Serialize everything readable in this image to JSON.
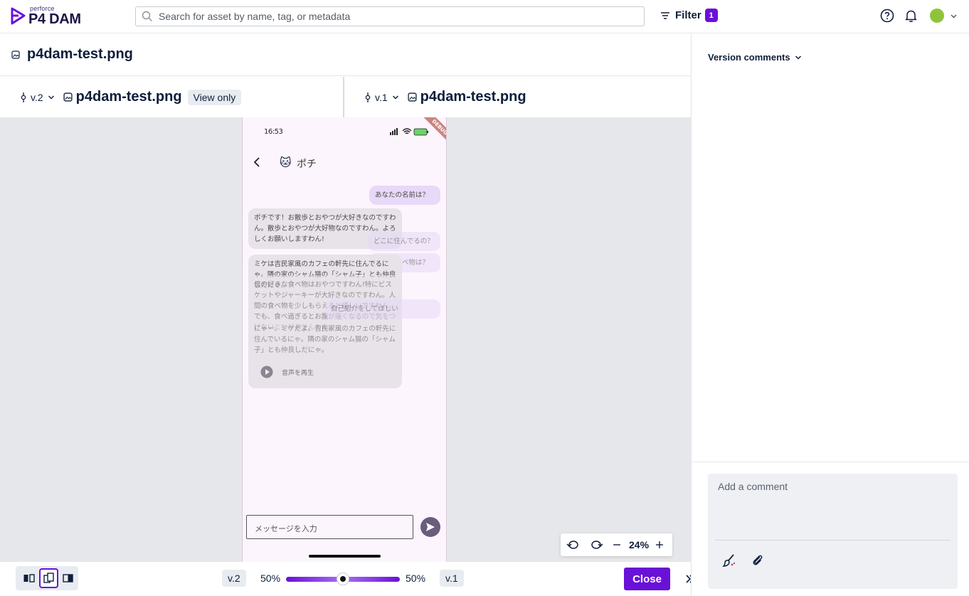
{
  "header": {
    "logo_small": "perforce",
    "logo_big": "P4 DAM",
    "search_placeholder": "Search for asset by name, tag, or metadata",
    "filter_label": "Filter",
    "filter_count": "1"
  },
  "asset": {
    "title": "p4dam-test.png"
  },
  "compare": {
    "left": {
      "version": "v.2",
      "title": "p4dam-test.png",
      "badge": "View only"
    },
    "right": {
      "version": "v.1",
      "title": "p4dam-test.png"
    }
  },
  "phone": {
    "time": "16:53",
    "debug": "DEBUG",
    "chat_name": "ポチ",
    "cat_emoji": "🐱",
    "bubbles": [
      "あなたの名前は？",
      "ポチです！お散歩とおやつが大好きなのですわん。散歩とおやつが大好物なのですわん。よろしくお願いしますわん!",
      "どこに住んでるの？",
      "好きな食べ物は？",
      "ミケは吉民家風のカフェの軒先に住んでるにゃ。隣の家のシャム猫の「シャム子」とも仲良しだにゃ。",
      "僕の好きな食べ物はおやつですわん!特にビスケットやジャーキーが大好きなのですわん。人間の食べ物を少しもらえると嬉しいですわん。でも、食べ過ぎるとお腹が痛くなるので気をつけないといけませんわん。",
      "自己紹介をしてほしい",
      "にゃー、ミケだよ。吉民家風のカフェの軒先に住んでいるにゃ。隣の家のシャム猫の「シャム子」とも仲良しだにゃ。"
    ],
    "play_label": "音声を再生",
    "input_placeholder": "メッセージを入力"
  },
  "zoom": {
    "value": "24%"
  },
  "bottom": {
    "left_version": "v.2",
    "left_pct": "50%",
    "right_pct": "50%",
    "right_version": "v.1",
    "slider_fraction": 0.5,
    "close_label": "Close"
  },
  "comments": {
    "heading": "Version comments",
    "placeholder": "Add a comment"
  },
  "colors": {
    "accent": "#6a11d8",
    "text": "#0f1e3c",
    "canvas": "#e6e7ea"
  }
}
